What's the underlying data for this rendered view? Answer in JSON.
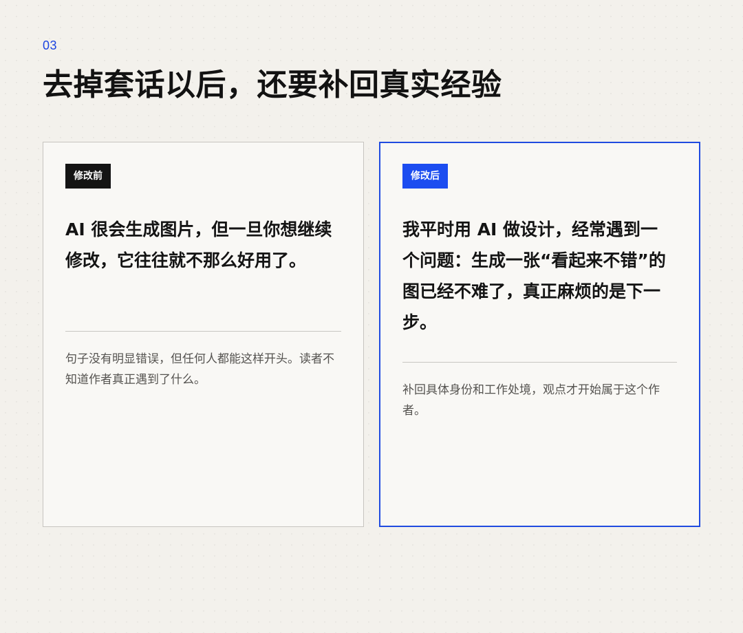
{
  "page": {
    "number": "03",
    "title": "去掉套话以后，还要补回真实经验"
  },
  "before": {
    "badge": "修改前",
    "headline": "AI 很会生成图片，但一旦你想继续修改，它往往就不那么好用了。",
    "note": "句子没有明显错误，但任何人都能这样开头。读者不知道作者真正遇到了什么。"
  },
  "after": {
    "badge": "修改后",
    "headline": "我平时用 AI 做设计，经常遇到一个问题：生成一张“看起来不错”的图已经不难了，真正麻烦的是下一步。",
    "note": "补回具体身份和工作处境，观点才开始属于这个作者。"
  },
  "colors": {
    "background": "#f3f1ec",
    "accent": "#1c4df0",
    "before_badge": "#141414",
    "text": "#141414",
    "muted_text": "#555350"
  }
}
